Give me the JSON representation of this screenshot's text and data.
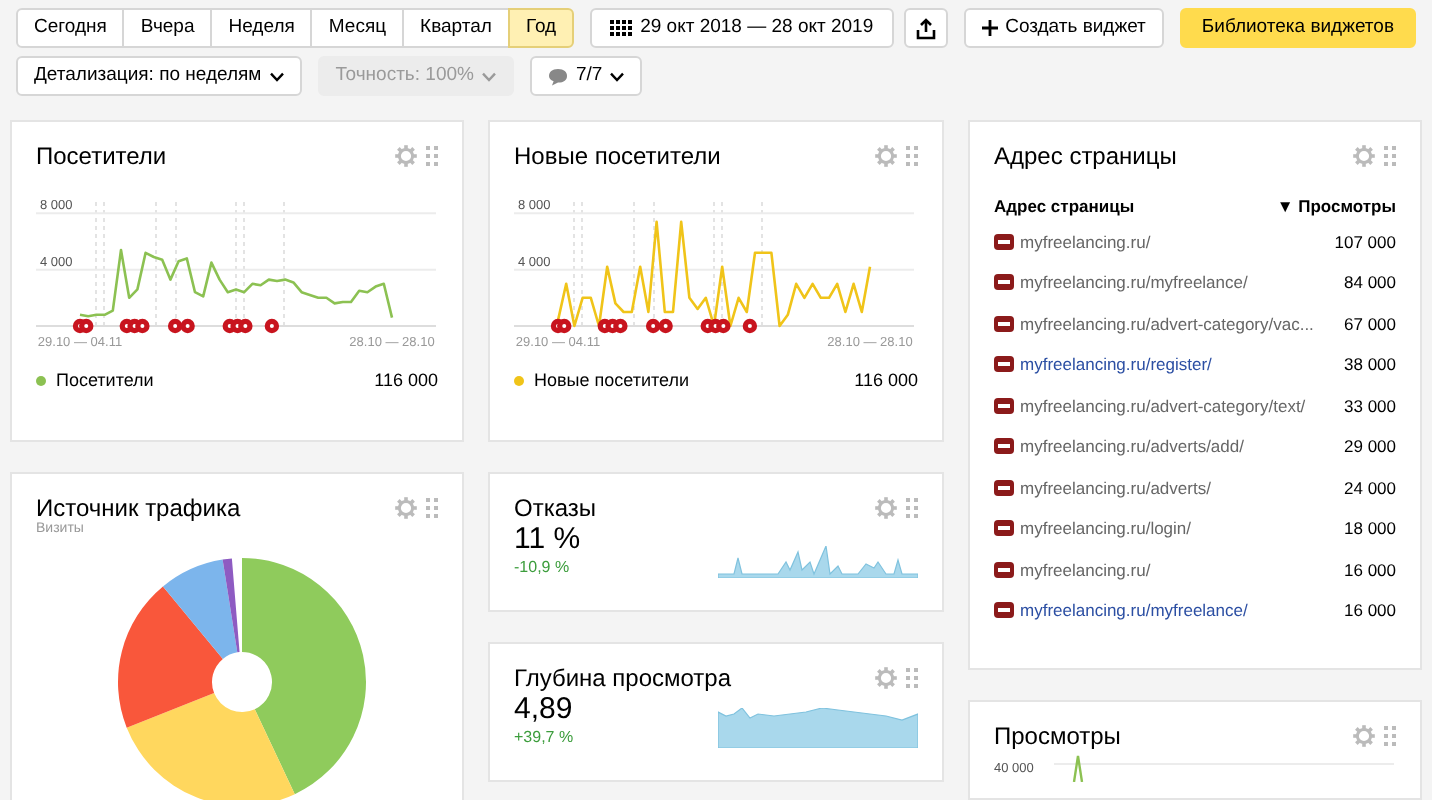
{
  "toolbar": {
    "periods": [
      {
        "label": "Сегодня",
        "selected": false
      },
      {
        "label": "Вчера",
        "selected": false
      },
      {
        "label": "Неделя",
        "selected": false
      },
      {
        "label": "Месяц",
        "selected": false
      },
      {
        "label": "Квартал",
        "selected": false
      },
      {
        "label": "Год",
        "selected": true
      }
    ],
    "date_range": "29 окт 2018 — 28 окт 2019",
    "create_widget": "Создать виджет",
    "widget_library": "Библиотека виджетов"
  },
  "filters": [
    {
      "kind": "dropdown",
      "label": "Детализация: по неделям",
      "disabled": false
    },
    {
      "kind": "dropdown",
      "label": "Точность: 100%",
      "disabled": true
    },
    {
      "kind": "comments",
      "label": "7/7",
      "disabled": false
    }
  ],
  "visitors": {
    "title": "Посетители",
    "chart_data": {
      "type": "line",
      "categories": [
        "29.10 — 04.11",
        null,
        null,
        null,
        null,
        null,
        null,
        null,
        null,
        null,
        null,
        null,
        null,
        null,
        null,
        null,
        null,
        null,
        null,
        null,
        null,
        null,
        null,
        null,
        null,
        null,
        null,
        null,
        null,
        null,
        null,
        null,
        null,
        null,
        null,
        null,
        null,
        null,
        "28.10 — 28.10"
      ],
      "series": [
        {
          "name": "Посетители",
          "color": "#8cc152",
          "values": [
            800,
            700,
            800,
            800,
            1100,
            5400,
            2000,
            2600,
            5200,
            4900,
            4700,
            3300,
            4600,
            4800,
            2400,
            2100,
            4500,
            3300,
            2400,
            2600,
            2400,
            3000,
            2900,
            3300,
            3200,
            3300,
            3100,
            2400,
            2200,
            2000,
            2000,
            1600,
            1700,
            1700,
            2500,
            2400,
            2800,
            3000,
            600
          ]
        }
      ],
      "ylim": [
        0,
        8800
      ],
      "yticks": [
        {
          "value": 4000,
          "label": "4 000"
        },
        {
          "value": 8000,
          "label": "8 000"
        }
      ]
    },
    "total": "116 000"
  },
  "new_visitors": {
    "title": "Новые посетители",
    "chart_data": {
      "type": "line",
      "categories": [
        "29.10 — 04.11",
        null,
        null,
        null,
        null,
        null,
        null,
        null,
        null,
        null,
        null,
        null,
        null,
        null,
        null,
        null,
        null,
        null,
        null,
        null,
        null,
        null,
        null,
        null,
        null,
        null,
        null,
        null,
        null,
        null,
        null,
        null,
        null,
        null,
        null,
        null,
        null,
        null,
        "28.10 — 28.10"
      ],
      "series": [
        {
          "name": "Новые посетители",
          "color": "#f0c419",
          "values": [
            400,
            3000,
            0,
            2000,
            2000,
            0,
            4200,
            1600,
            1000,
            1000,
            4200,
            1000,
            7400,
            1000,
            1000,
            7400,
            2000,
            1200,
            2000,
            0,
            4200,
            0,
            2000,
            1000,
            5200,
            5200,
            5200,
            0,
            800,
            3000,
            2000,
            3000,
            2000,
            2000,
            3000,
            1000,
            3000,
            1000,
            4200
          ]
        }
      ],
      "ylim": [
        0,
        8800
      ],
      "yticks": [
        {
          "value": 4000,
          "label": "4 000"
        },
        {
          "value": 8000,
          "label": "8 000"
        }
      ]
    },
    "total": "116 000"
  },
  "pages": {
    "title": "Адрес страницы",
    "columns": [
      "Адрес страницы",
      "▼ Просмотры"
    ],
    "rows": [
      {
        "url": "myfreelancing.ru/",
        "views": "107 000",
        "visited": true
      },
      {
        "url": "myfreelancing.ru/myfreelance/",
        "views": "84 000",
        "visited": true
      },
      {
        "url": "myfreelancing.ru/advert-category/vac...",
        "views": "67 000",
        "visited": true
      },
      {
        "url": "myfreelancing.ru/register/",
        "views": "38 000",
        "visited": false
      },
      {
        "url": "myfreelancing.ru/advert-category/text/",
        "views": "33 000",
        "visited": true
      },
      {
        "url": "myfreelancing.ru/adverts/add/",
        "views": "29 000",
        "visited": true
      },
      {
        "url": "myfreelancing.ru/adverts/",
        "views": "24 000",
        "visited": true
      },
      {
        "url": "myfreelancing.ru/login/",
        "views": "18 000",
        "visited": true
      },
      {
        "url": "myfreelancing.ru/",
        "views": "16 000",
        "visited": true
      },
      {
        "url": "myfreelancing.ru/myfreelance/",
        "views": "16 000",
        "visited": false
      }
    ]
  },
  "traffic_source": {
    "title": "Источник трафика",
    "subtitle": "Визиты"
  },
  "bounces": {
    "title": "Отказы",
    "value": "11 %",
    "change": "-10,9 %"
  },
  "depth": {
    "title": "Глубина просмотра",
    "value": "4,89",
    "change": "+39,7 %"
  },
  "views": {
    "title": "Просмотры",
    "tick": "40 000"
  }
}
